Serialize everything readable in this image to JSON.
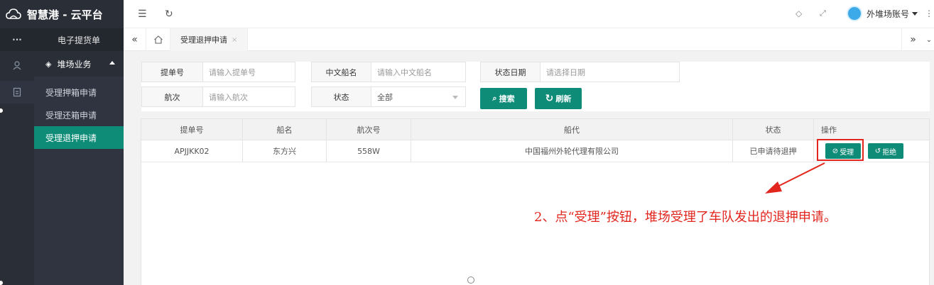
{
  "app": {
    "title": "智慧港 - 云平台"
  },
  "rail": {
    "more_label": "···"
  },
  "menu": {
    "top_item": "电子提货单",
    "group": "堆场业务",
    "items": [
      {
        "label": "受理押箱申请",
        "active": false
      },
      {
        "label": "受理还箱申请",
        "active": false
      },
      {
        "label": "受理退押申请",
        "active": true
      }
    ]
  },
  "header": {
    "account": "外堆场账号"
  },
  "tabs": [
    {
      "label": "受理退押申请",
      "close": "×"
    }
  ],
  "form": {
    "bill_no": {
      "label": "提单号",
      "placeholder": "请输入提单号"
    },
    "ship_name": {
      "label": "中文船名",
      "placeholder": "请输入中文船名"
    },
    "status_date": {
      "label": "状态日期",
      "placeholder": "请选择日期"
    },
    "voyage": {
      "label": "航次",
      "placeholder": "请输入航次"
    },
    "status": {
      "label": "状态",
      "value": "全部"
    },
    "search_label": "搜索",
    "refresh_label": "刷新"
  },
  "table": {
    "columns": [
      "提单号",
      "船名",
      "航次号",
      "船代",
      "状态",
      "操作"
    ],
    "rows": [
      {
        "bill_no": "APJJKK02",
        "ship": "东方兴",
        "voyage": "558W",
        "agent": "中国福州外轮代理有限公司",
        "status": "已申请待退押",
        "accept": "受理",
        "reject": "拒绝"
      }
    ]
  },
  "annotation": "2、点“受理”按钮，堆场受理了车队发出的退押申请。",
  "colors": {
    "accent": "#0f8c78",
    "sidebar": "#2f3440",
    "annotation": "#e2261e"
  }
}
